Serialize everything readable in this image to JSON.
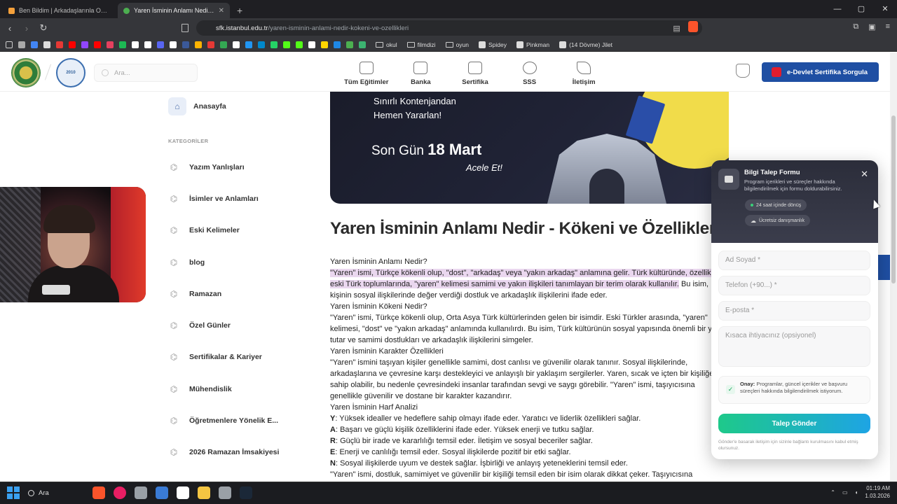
{
  "browser": {
    "tabs": [
      {
        "title": "Ben Bildim | Arkadaşlarınla Online Bi...",
        "favicon_color": "#f4a03b",
        "active": false
      },
      {
        "title": "Yaren İsminin Anlamı Nedir - Köke...",
        "favicon_color": "#4caf50",
        "active": true
      }
    ],
    "new_tab": "+",
    "window_controls": [
      "—",
      "▢",
      "✕"
    ],
    "url_domain": "sfk.istanbul.edu.tr",
    "url_path": "/yaren-isminin-anlami-nedir-kokeni-ve-ozellikleri",
    "bookmarks_folders": [
      "okul",
      "filmdizi",
      "oyun"
    ],
    "bookmarks_links": [
      "Spidey",
      "Pinkman",
      "(14 Dövme) Jilet"
    ],
    "bookmark_icon_colors": [
      "#aaa",
      "#4285f4",
      "#ddd",
      "#e53935",
      "#ff0000",
      "#9146ff",
      "#ff0000",
      "#e4405f",
      "#1db954",
      "#fff",
      "#fff",
      "#5865f2",
      "#fff",
      "#3b5998",
      "#ffb300",
      "#e53935",
      "#34a853",
      "#fff",
      "#2196f3",
      "#0088cc",
      "#25d366",
      "#53fc18",
      "#53fc18",
      "#fff",
      "#ffd600",
      "#1e88e5",
      "#4caf50",
      "#3cb371"
    ]
  },
  "site": {
    "search_placeholder": "Ara...",
    "logo2_text": "2010",
    "nav": [
      "Tüm Eğitimler",
      "Banka",
      "Sertifika",
      "SSS",
      "İletişim"
    ],
    "edevlet_label": "e-Devlet Sertifika Sorgula"
  },
  "sidebar": {
    "home": "Anasayfa",
    "categories_heading": "KATEGORİLER",
    "categories": [
      "Yazım Yanlışları",
      "İsimler ve Anlamları",
      "Eski Kelimeler",
      "blog",
      "Ramazan",
      "Özel Günler",
      "Sertifikalar & Kariyer",
      "Mühendislik",
      "Öğretmenlere Yönelik E...",
      "2026 Ramazan İmsakiyesi"
    ]
  },
  "hero": {
    "line1": "Sınırlı Kontenjandan",
    "line2": "Hemen Yararlan!",
    "deadline_prefix": "Son Gün",
    "deadline_date": "18 Mart",
    "cta": "Acele Et!"
  },
  "article": {
    "title": "Yaren İsminin Anlamı Nedir - Kökeni ve Özellikleri?",
    "p1": "Yaren İsminin Anlamı Nedir?",
    "p2_hl": "\"Yaren\" ismi, Türkçe kökenli olup, \"dost\", \"arkadaş\" veya \"yakın arkadaş\" anlamına gelir. Türk kültüründe, özellikle",
    "p3_hl": "eski Türk toplumlarında, \"yaren\" kelimesi samimi ve yakın ilişkileri tanımlayan bir terim olarak kullanılır.",
    "p3_rest": " Bu isim,",
    "p4": "kişinin sosyal ilişkilerinde değer verdiği dostluk ve arkadaşlık ilişkilerini ifade eder.",
    "p5": "Yaren İsminin Kökeni Nedir?",
    "p6": "\"Yaren\" ismi, Türkçe kökenli olup, Orta Asya Türk kültürlerinden gelen bir isimdir. Eski Türkler arasında, \"yaren\"",
    "p7": "kelimesi, \"dost\" ve \"yakın arkadaş\" anlamında kullanılırdı. Bu isim, Türk kültürünün sosyal yapısında önemli bir yer",
    "p8": "tutar ve samimi dostlukları ve arkadaşlık ilişkilerini simgeler.",
    "p9": "Yaren İsminin Karakter Özellikleri",
    "p10": "\"Yaren\" ismini taşıyan kişiler genellikle samimi, dost canlısı ve güvenilir olarak tanınır. Sosyal ilişkilerinde,",
    "p11": "arkadaşlarına ve çevresine karşı destekleyici ve anlayışlı bir yaklaşım sergilerler. Yaren, sıcak ve içten bir kişiliğe",
    "p12": "sahip olabilir, bu nedenle çevresindeki insanlar tarafından sevgi ve saygı görebilir. \"Yaren\" ismi, taşıyıcısına",
    "p13": "genellikle güvenilir ve dostane bir karakter kazandırır.",
    "p14": "Yaren İsminin Harf Analizi",
    "letters": [
      {
        "l": "Y",
        "t": ": Yüksek idealler ve hedeflere sahip olmayı ifade eder. Yaratıcı ve liderlik özellikleri sağlar."
      },
      {
        "l": "A",
        "t": ": Başarı ve güçlü kişilik özelliklerini ifade eder. Yüksek enerji ve tutku sağlar."
      },
      {
        "l": "R",
        "t": ": Güçlü bir irade ve kararlılığı temsil eder. İletişim ve sosyal beceriler sağlar."
      },
      {
        "l": "E",
        "t": ": Enerji ve canlılığı temsil eder. Sosyal ilişkilerde pozitif bir etki sağlar."
      },
      {
        "l": "N",
        "t": ": Sosyal ilişkilerde uyum ve destek sağlar. İşbirliği ve anlayış yeteneklerini temsil eder."
      }
    ],
    "p_last": "\"Yaren\" ismi, dostluk, samimiyet ve güvenilir bir kişiliği temsil eden bir isim olarak dikkat çeker. Taşıyıcısına"
  },
  "form": {
    "title": "Bilgi Talep Formu",
    "subtitle": "Program içerikleri ve süreçler hakkında bilgilendirilmek için formu doldurabilirsiniz.",
    "badge1": "24 saat içinde dönüş",
    "badge2": "Ücretsiz danışmanlık",
    "name_placeholder": "Ad Soyad *",
    "phone_placeholder": "Telefon (+90...) *",
    "email_placeholder": "E-posta *",
    "need_placeholder": "Kısaca ihtiyacınız (opsiyonel)",
    "consent_bold": "Onay:",
    "consent_text": " Programlar, güncel içerikler ve başvuru süreçleri hakkında bilgilendirilmek istiyorum.",
    "submit": "Talep Gönder",
    "footer": "Gönder'e basarak iletişim için sizinle bağlantı kurulmasını kabul etmiş olursunuz."
  },
  "taskbar": {
    "search": "Ara",
    "time": "01:19 AM",
    "date": "1.03.2026",
    "app_colors": [
      "#fb542b",
      "#e91e63",
      "#9aa0a6",
      "#3a7bd5",
      "#ffffff",
      "#f4c542",
      "#9aa0a6",
      "#1b2838"
    ]
  }
}
